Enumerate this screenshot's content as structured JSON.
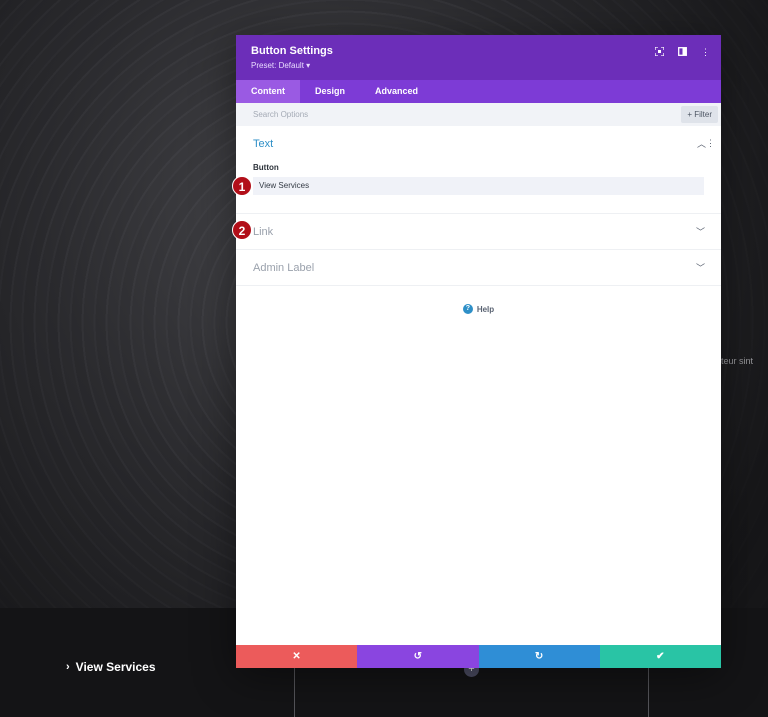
{
  "background": {
    "side_text": "pteur sint",
    "link_text": "View Services",
    "link_icon": "chevron-right-icon"
  },
  "modal": {
    "title": "Button Settings",
    "preset": "Preset: Default ▾",
    "tabs": [
      "Content",
      "Design",
      "Advanced"
    ],
    "active_tab": "Content",
    "search": {
      "placeholder": "Search Options",
      "filter_label": "+ Filter"
    },
    "sections": {
      "text": {
        "title": "Text",
        "field_label": "Button",
        "field_value": "View Services"
      },
      "link": {
        "title": "Link"
      },
      "admin": {
        "title": "Admin Label"
      }
    },
    "help_label": "Help",
    "footer": [
      "cancel-icon",
      "undo-icon",
      "redo-icon",
      "save-icon"
    ]
  },
  "markers": [
    "1",
    "2"
  ],
  "colors": {
    "header": "#6c2eb9",
    "tabs": "#7d3bd6",
    "accent_blue": "#2e8fc7",
    "cancel": "#ec5b5b",
    "undo": "#8a45e0",
    "redo": "#2f8ed6",
    "save": "#29c4a5",
    "marker": "#b20f19"
  }
}
